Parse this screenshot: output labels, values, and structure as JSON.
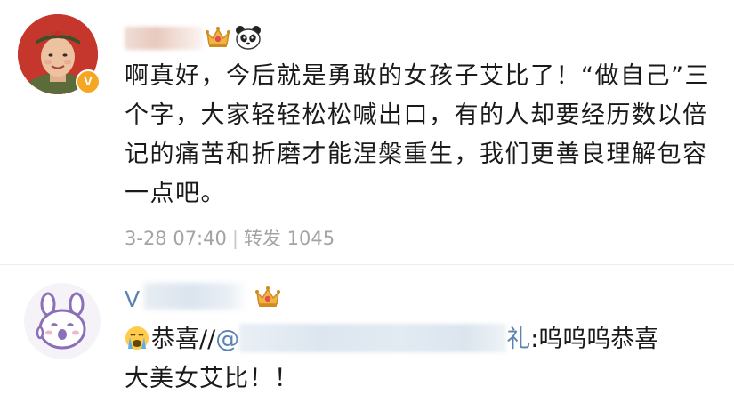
{
  "post": {
    "text": "啊真好，今后就是勇敢的女孩子艾比了！“做自己”三个字，大家轻轻松松喊出口，有的人却要经历数以倍记的痛苦和折磨才能涅槃重生，我们更善良理解包容一点吧。",
    "date": "3-28 07:40",
    "separator": "|",
    "repost_label": "转发",
    "repost_count": "1045",
    "username": "",
    "vip_badge": "V"
  },
  "reply": {
    "v_prefix": "V",
    "emoji": "crying-face",
    "text_start": "恭喜//",
    "mention_at": "@",
    "mention_tail": "礼",
    "text_end": ":呜呜呜恭喜",
    "line2": "大美女艾比！！"
  },
  "icons": {
    "crown": "crown-icon",
    "panda": "panda-icon",
    "cry": "crying-emoji-icon"
  },
  "colors": {
    "link_blue": "#5b83b1",
    "meta_gray": "#a3a3a3",
    "text": "#1a1a1a",
    "crown_gold": "#e8a33b"
  }
}
